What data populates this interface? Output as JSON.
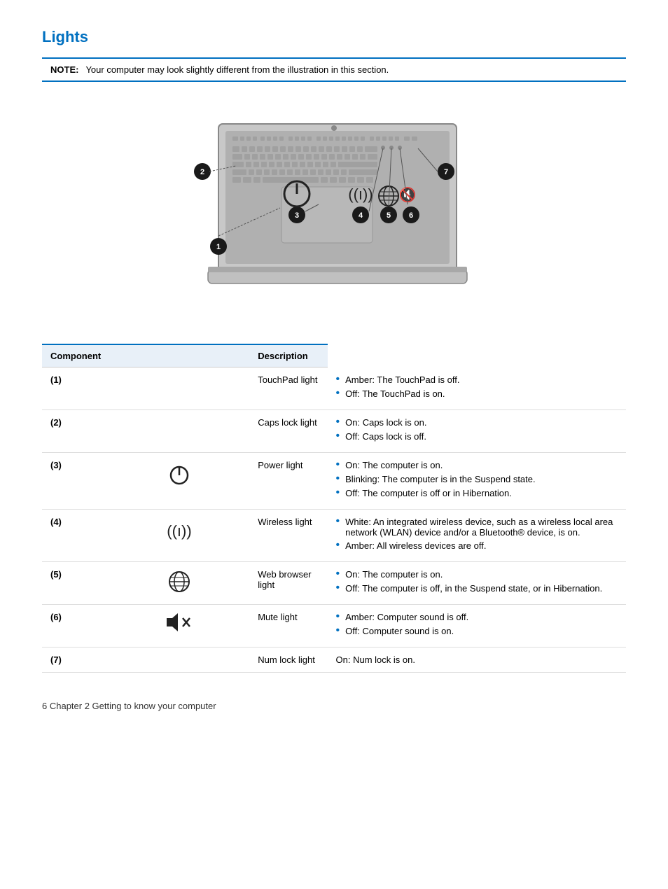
{
  "page": {
    "title": "Lights",
    "note_label": "NOTE:",
    "note_text": "Your computer may look slightly different from the illustration in this section.",
    "footer": "6    Chapter 2   Getting to know your computer"
  },
  "table": {
    "col_component": "Component",
    "col_description": "Description",
    "rows": [
      {
        "id": "(1)",
        "icon": null,
        "name": "TouchPad light",
        "bullets": [
          "Amber: The TouchPad is off.",
          "Off: The TouchPad is on."
        ]
      },
      {
        "id": "(2)",
        "icon": null,
        "name": "Caps lock light",
        "bullets": [
          "On: Caps lock is on.",
          "Off: Caps lock is off."
        ]
      },
      {
        "id": "(3)",
        "icon": "power",
        "name": "Power light",
        "bullets": [
          "On: The computer is on.",
          "Blinking: The computer is in the Suspend state.",
          "Off: The computer is off or in Hibernation."
        ]
      },
      {
        "id": "(4)",
        "icon": "wireless",
        "name": "Wireless light",
        "bullets": [
          "White: An integrated wireless device, such as a wireless local area network (WLAN) device and/or a Bluetooth® device, is on.",
          "Amber: All wireless devices are off."
        ]
      },
      {
        "id": "(5)",
        "icon": "web",
        "name": "Web browser light",
        "bullets": [
          "On: The computer is on.",
          "Off: The computer is off, in the Suspend state, or in Hibernation."
        ]
      },
      {
        "id": "(6)",
        "icon": "mute",
        "name": "Mute light",
        "bullets": [
          "Amber: Computer sound is off.",
          "Off: Computer sound is on."
        ]
      },
      {
        "id": "(7)",
        "icon": null,
        "name": "Num lock light",
        "bullets": [],
        "single": "On: Num lock is on."
      }
    ]
  }
}
